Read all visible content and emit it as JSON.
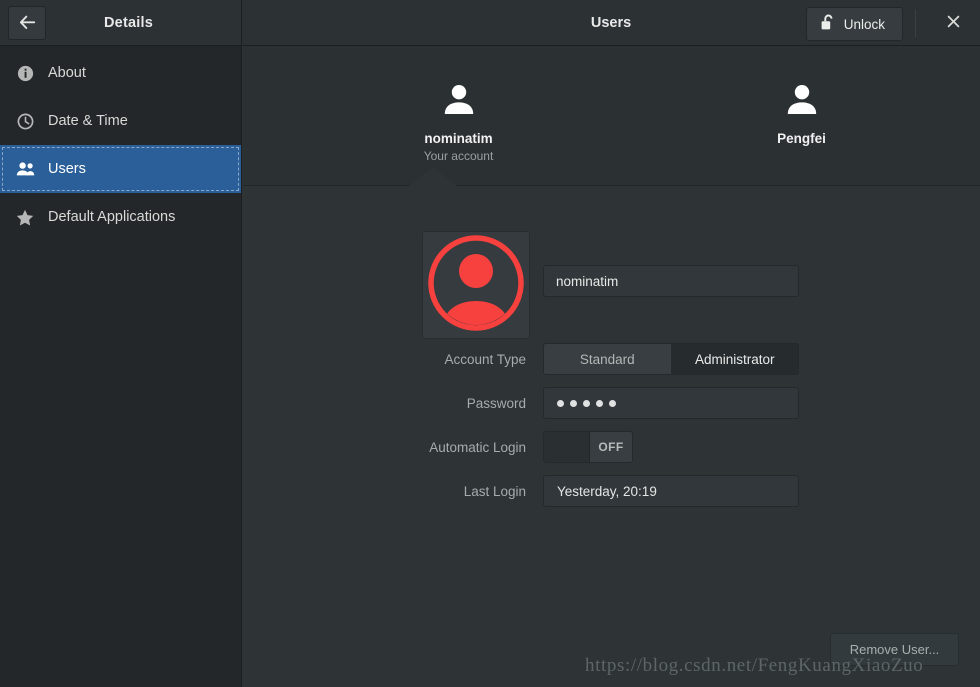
{
  "window": {
    "sidebar_title": "Details",
    "main_title": "Users",
    "back_icon": "back-arrow-icon",
    "unlock_label": "Unlock",
    "unlock_icon": "open-padlock-icon",
    "close_icon": "close-icon"
  },
  "sidebar": {
    "items": [
      {
        "label": "About",
        "icon": "info-icon",
        "selected": false
      },
      {
        "label": "Date & Time",
        "icon": "clock-icon",
        "selected": false
      },
      {
        "label": "Users",
        "icon": "users-icon",
        "selected": true
      },
      {
        "label": "Default Applications",
        "icon": "star-icon",
        "selected": false
      }
    ]
  },
  "user_tabs": [
    {
      "name": "nominatim",
      "subtitle": "Your account",
      "selected": true
    },
    {
      "name": "Pengfei",
      "subtitle": "",
      "selected": false
    }
  ],
  "account": {
    "avatar_icon": "user-avatar-icon",
    "username_value": "nominatim",
    "fields": {
      "account_type_label": "Account Type",
      "account_type_options": [
        "Standard",
        "Administrator"
      ],
      "account_type_selected": "Administrator",
      "password_label": "Password",
      "password_masked": "•••••",
      "password_dot_count": 5,
      "automatic_login_label": "Automatic Login",
      "automatic_login_state": "OFF",
      "last_login_label": "Last Login",
      "last_login_value": "Yesterday, 20:19"
    },
    "remove_user_label": "Remove User..."
  },
  "watermark": "https://blog.csdn.net/FengKuangXiaoZuo",
  "colors": {
    "window_bg": "#2e3436",
    "sidebar_bg": "#242729",
    "headerbar_bg": "#2c3134",
    "tabstrip_bg": "#2b3033",
    "accent_blue": "#2a5f99",
    "avatar_red": "#f7413f",
    "field_bg": "#31373a",
    "muted_text": "#a6acaa"
  }
}
